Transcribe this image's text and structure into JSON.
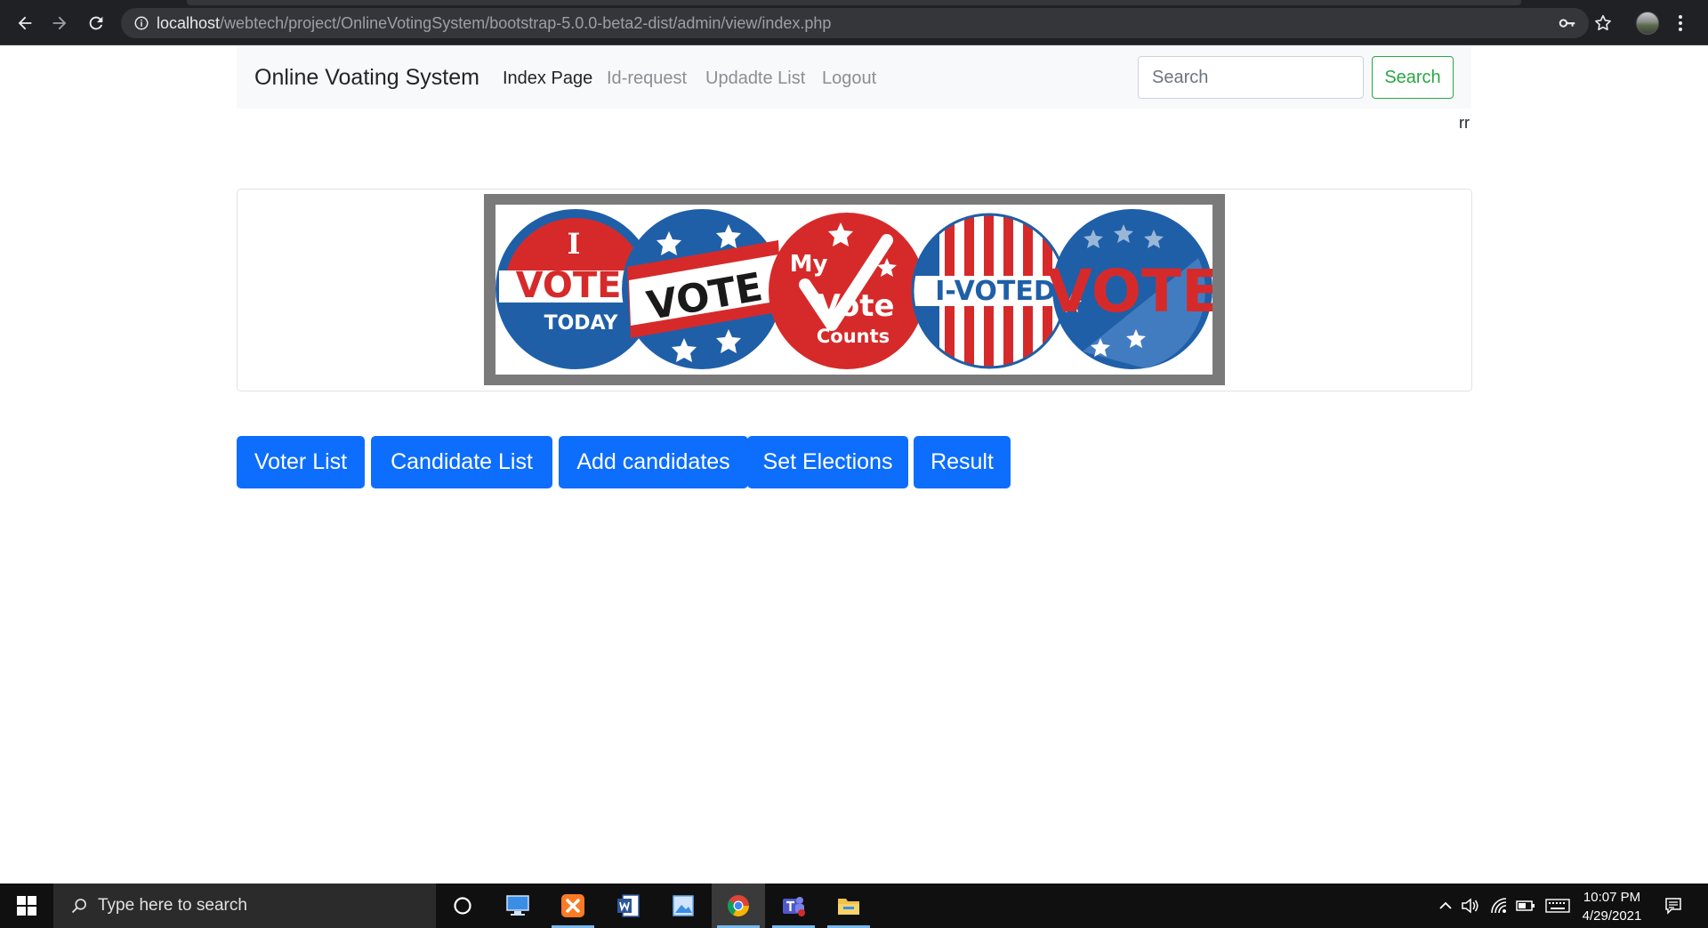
{
  "browser": {
    "url_host": "localhost",
    "url_path": "/webtech/project/OnlineVotingSystem/bootstrap-5.0.0-beta2-dist/admin/view/index.php"
  },
  "navbar": {
    "brand": "Online Voating System",
    "links": [
      {
        "label": "Index Page",
        "active": true
      },
      {
        "label": "Id-request",
        "active": false
      },
      {
        "label": "Updadte List",
        "active": false
      },
      {
        "label": "Logout",
        "active": false
      }
    ],
    "search_placeholder": "Search",
    "search_button": "Search"
  },
  "user_text": "rr",
  "banner": {
    "badges": [
      {
        "lines": [
          "I",
          "VOTE",
          "TODAY"
        ]
      },
      {
        "lines": [
          "VOTE"
        ]
      },
      {
        "lines": [
          "My",
          "Vote",
          "Counts"
        ]
      },
      {
        "lines": [
          "I-VOTED"
        ]
      },
      {
        "lines": [
          "VOTE"
        ]
      }
    ]
  },
  "actions": [
    {
      "label": "Voter List"
    },
    {
      "label": "Candidate List"
    },
    {
      "label": "Add candidates"
    },
    {
      "label": "Set Elections"
    },
    {
      "label": "Result"
    }
  ],
  "taskbar": {
    "search_placeholder": "Type here to search",
    "time": "10:07 PM",
    "date": "4/29/2021"
  },
  "colors": {
    "primary": "#0d6efd",
    "success": "#28a745",
    "badge_red": "#d62a2a",
    "badge_blue": "#1f5fa8"
  }
}
